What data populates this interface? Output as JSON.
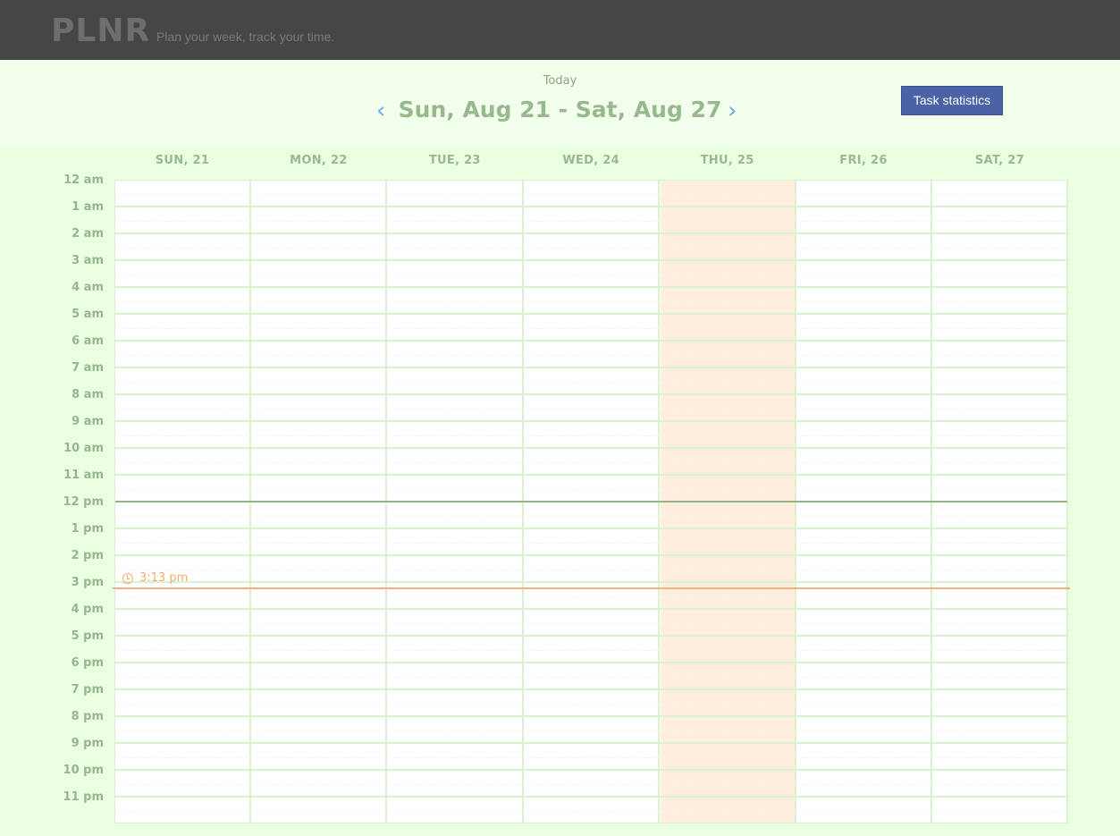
{
  "app": {
    "logo": "PLNR",
    "tagline": "Plan your week, track your time."
  },
  "week": {
    "today_label": "Today",
    "range_title": "Sun, Aug 21 - Sat, Aug 27",
    "prev_icon": "chevron-left-icon",
    "next_icon": "chevron-right-icon",
    "stats_button": "Task statistics"
  },
  "days": [
    {
      "label": "SUN, 21",
      "is_today": false
    },
    {
      "label": "MON, 22",
      "is_today": false
    },
    {
      "label": "TUE, 23",
      "is_today": false
    },
    {
      "label": "WED, 24",
      "is_today": false
    },
    {
      "label": "THU, 25",
      "is_today": true
    },
    {
      "label": "FRI, 26",
      "is_today": false
    },
    {
      "label": "SAT, 27",
      "is_today": false
    }
  ],
  "hours": [
    "12 am",
    "1 am",
    "2 am",
    "3 am",
    "4 am",
    "5 am",
    "6 am",
    "7 am",
    "8 am",
    "9 am",
    "10 am",
    "11 am",
    "12 pm",
    "1 pm",
    "2 pm",
    "3 pm",
    "4 pm",
    "5 pm",
    "6 pm",
    "7 pm",
    "8 pm",
    "9 pm",
    "10 pm",
    "11 pm"
  ],
  "now": {
    "time_label": "3:13 pm",
    "icon": "clock-icon"
  },
  "colors": {
    "topbar": "#464646",
    "accent_green": "#98b98d",
    "today_column": "#ffeedd",
    "now_line": "#f3b07f",
    "button": "#4a62a6"
  }
}
